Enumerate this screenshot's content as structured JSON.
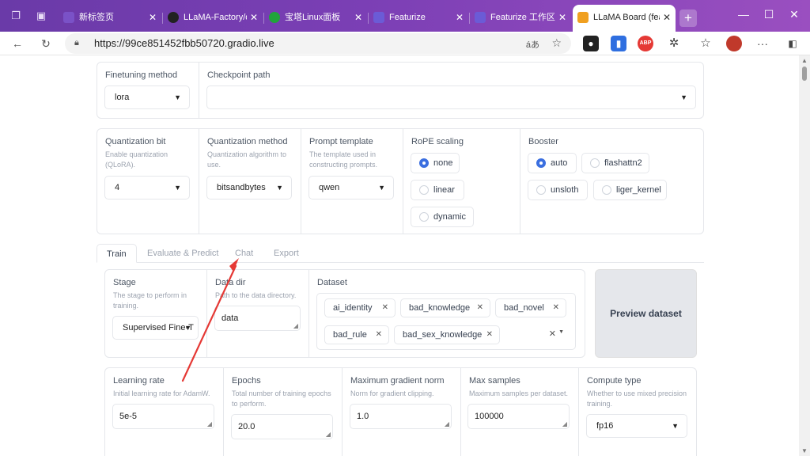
{
  "browser": {
    "tabs": [
      {
        "label": "新标签页",
        "fav_color": "#7a52c7"
      },
      {
        "label": "LLaMA-Factory/data",
        "fav_color": "#222222"
      },
      {
        "label": "宝塔Linux面板",
        "fav_color": "#20a53a"
      },
      {
        "label": "Featurize",
        "fav_color": "#6b5bd6"
      },
      {
        "label": "Featurize 工作区",
        "fav_color": "#6b5bd6"
      },
      {
        "label": "LLaMA Board (featu",
        "fav_color": "#f0a020"
      }
    ],
    "new_tab": "+",
    "url": "https://99ce851452fbb50720.gradio.live",
    "read_aloud": "áあ",
    "win_minimize": "—",
    "win_maximize": "☐",
    "win_close": "✕",
    "ext_abp": "ABP"
  },
  "top_row": {
    "finetuning_method": {
      "label": "Finetuning method",
      "value": "lora"
    },
    "checkpoint_path": {
      "label": "Checkpoint path",
      "value": ""
    }
  },
  "quant_row": {
    "quantization_bit": {
      "label": "Quantization bit",
      "info": "Enable quantization (QLoRA).",
      "value": "4"
    },
    "quantization_method": {
      "label": "Quantization method",
      "info": "Quantization algorithm to use.",
      "value": "bitsandbytes"
    },
    "prompt_template": {
      "label": "Prompt template",
      "info": "The template used in constructing prompts.",
      "value": "qwen"
    },
    "rope_scaling": {
      "label": "RoPE scaling",
      "options": [
        "none",
        "linear",
        "dynamic"
      ],
      "selected": "none"
    },
    "booster": {
      "label": "Booster",
      "options": [
        "auto",
        "flashattn2",
        "unsloth",
        "liger_kernel"
      ],
      "selected": "auto"
    }
  },
  "tabs": [
    "Train",
    "Evaluate & Predict",
    "Chat",
    "Export"
  ],
  "active_tab": "Train",
  "train": {
    "stage": {
      "label": "Stage",
      "info": "The stage to perform in training.",
      "value": "Supervised Fine-T"
    },
    "data_dir": {
      "label": "Data dir",
      "info": "Path to the data directory.",
      "value": "data"
    },
    "dataset": {
      "label": "Dataset",
      "chips": [
        "ai_identity",
        "bad_knowledge",
        "bad_novel",
        "bad_rule",
        "bad_sex_knowledge"
      ]
    },
    "preview_button": "Preview dataset",
    "learning_rate": {
      "label": "Learning rate",
      "info": "Initial learning rate for AdamW.",
      "value": "5e-5"
    },
    "epochs": {
      "label": "Epochs",
      "info": "Total number of training epochs to perform.",
      "value": "20.0"
    },
    "max_grad_norm": {
      "label": "Maximum gradient norm",
      "info": "Norm for gradient clipping.",
      "value": "1.0"
    },
    "max_samples": {
      "label": "Max samples",
      "info": "Maximum samples per dataset.",
      "value": "100000"
    },
    "compute_type": {
      "label": "Compute type",
      "info": "Whether to use mixed precision training.",
      "value": "fp16"
    }
  },
  "annotation": {
    "color": "#e53935"
  }
}
